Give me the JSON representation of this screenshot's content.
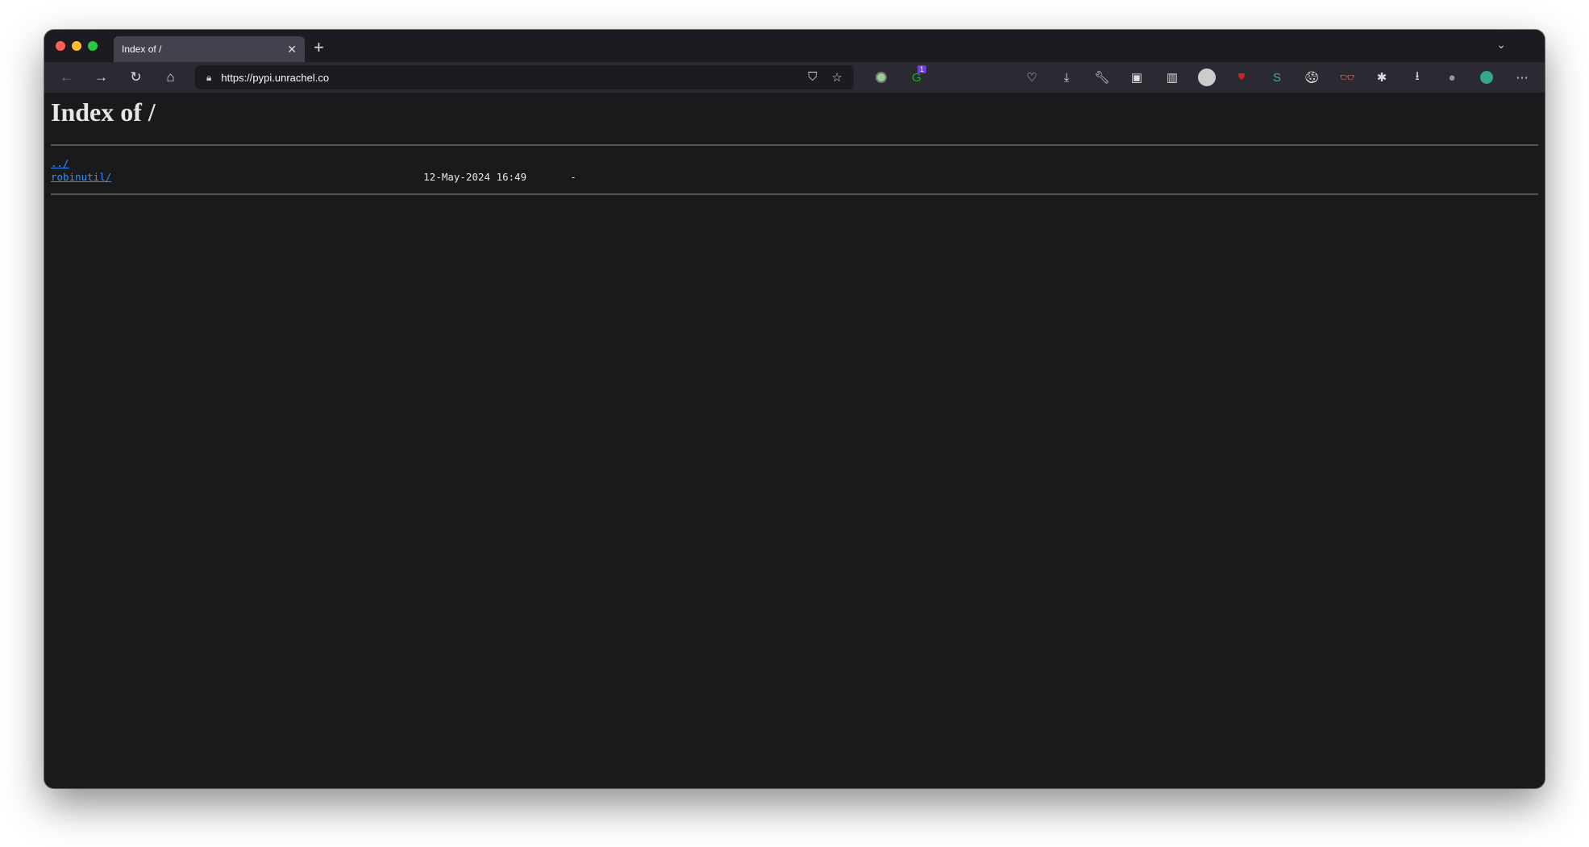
{
  "browser": {
    "tab_title": "Index of /",
    "url": "https://pypi.unrachel.co",
    "badge_count": "1"
  },
  "page": {
    "heading": "Index of /",
    "entries": [
      {
        "name": "../",
        "date": "",
        "size": ""
      },
      {
        "name": "robinutil/",
        "date": "12-May-2024 16:49",
        "size": "-"
      }
    ]
  }
}
